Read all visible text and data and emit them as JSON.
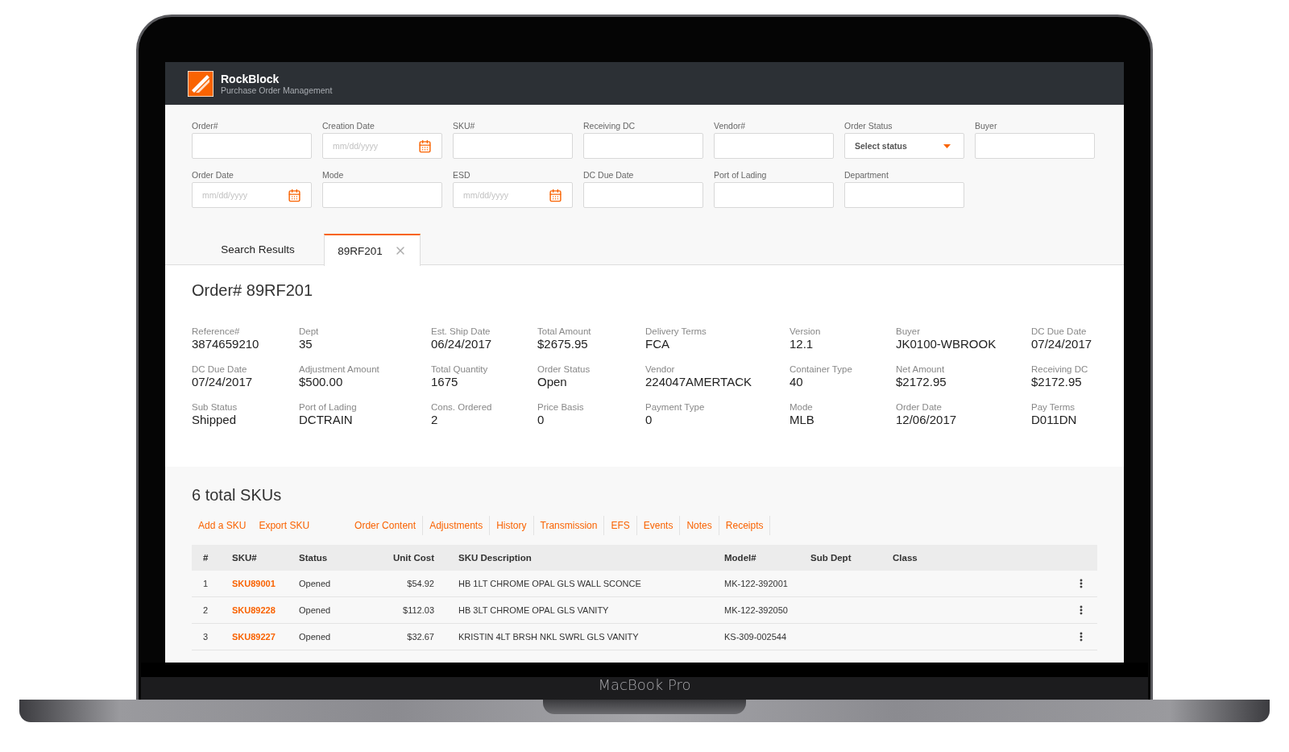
{
  "app": {
    "title": "RockBlock",
    "subtitle": "Purchase Order Management"
  },
  "filters": [
    {
      "label": "Order#",
      "kind": "text"
    },
    {
      "label": "Creation Date",
      "kind": "date",
      "placeholder": "mm/dd/yyyy"
    },
    {
      "label": "SKU#",
      "kind": "text"
    },
    {
      "label": "Receiving DC",
      "kind": "text"
    },
    {
      "label": "Vendor#",
      "kind": "text"
    },
    {
      "label": "Order Status",
      "kind": "select",
      "value": "Select status"
    },
    {
      "label": "Buyer",
      "kind": "text"
    },
    {
      "label": "Order Date",
      "kind": "date",
      "placeholder": "mm/dd/yyyy"
    },
    {
      "label": "Mode",
      "kind": "text"
    },
    {
      "label": "ESD",
      "kind": "date",
      "placeholder": "mm/dd/yyyy"
    },
    {
      "label": "DC Due Date",
      "kind": "text"
    },
    {
      "label": "Port of Lading",
      "kind": "text"
    },
    {
      "label": "Department",
      "kind": "text"
    }
  ],
  "tabs": [
    {
      "label": "Search Results",
      "selected": false,
      "closable": false
    },
    {
      "label": "89RF201",
      "selected": true,
      "closable": true
    }
  ],
  "order": {
    "title": "Order# 89RF201",
    "fields": [
      {
        "label": "Reference#",
        "value": "3874659210"
      },
      {
        "label": "Dept",
        "value": "35"
      },
      {
        "label": "Est. Ship Date",
        "value": "06/24/2017"
      },
      {
        "label": "Total Amount",
        "value": "$2675.95"
      },
      {
        "label": "Delivery Terms",
        "value": "FCA"
      },
      {
        "label": "Version",
        "value": "12.1"
      },
      {
        "label": "Buyer",
        "value": "JK0100-WBROOK"
      },
      {
        "label": "DC Due Date",
        "value": "07/24/2017"
      },
      {
        "label": "DC Due Date",
        "value": "07/24/2017"
      },
      {
        "label": "Adjustment Amount",
        "value": "$500.00"
      },
      {
        "label": "Total Quantity",
        "value": "1675"
      },
      {
        "label": "Order Status",
        "value": "Open"
      },
      {
        "label": "Vendor",
        "value": "224047AMERTACK"
      },
      {
        "label": "Container Type",
        "value": "40"
      },
      {
        "label": "Net Amount",
        "value": "$2172.95"
      },
      {
        "label": "Receiving DC",
        "value": "$2172.95"
      },
      {
        "label": "Sub Status",
        "value": "Shipped"
      },
      {
        "label": "Port of Lading",
        "value": "DCTRAIN"
      },
      {
        "label": "Cons. Ordered",
        "value": "2"
      },
      {
        "label": "Price Basis",
        "value": "0"
      },
      {
        "label": "Payment Type",
        "value": "0"
      },
      {
        "label": "Mode",
        "value": "MLB"
      },
      {
        "label": "Order Date",
        "value": "12/06/2017"
      },
      {
        "label": "Pay Terms",
        "value": "D011DN"
      }
    ]
  },
  "skus": {
    "title": "6 total SKUs",
    "actions": [
      {
        "label": "Add a SKU",
        "kind": "action"
      },
      {
        "label": "Export SKU",
        "kind": "action"
      },
      {
        "label": "Order Content",
        "kind": "tab"
      },
      {
        "label": "Adjustments",
        "kind": "tab"
      },
      {
        "label": "History",
        "kind": "tab"
      },
      {
        "label": "Transmission",
        "kind": "tab"
      },
      {
        "label": "EFS",
        "kind": "tab"
      },
      {
        "label": "Events",
        "kind": "tab"
      },
      {
        "label": "Notes",
        "kind": "tab"
      },
      {
        "label": "Receipts",
        "kind": "tab"
      }
    ],
    "table": {
      "columns": [
        "#",
        "SKU#",
        "Status",
        "Unit Cost",
        "SKU Description",
        "Model#",
        "Sub Dept",
        "Class"
      ],
      "rows": [
        [
          "1",
          "SKU89001",
          "Opened",
          "$54.92",
          "HB 1LT CHROME OPAL GLS WALL SCONCE",
          "MK-122-392001"
        ],
        [
          "2",
          "SKU89228",
          "Opened",
          "$112.03",
          "HB 3LT CHROME OPAL GLS VANITY",
          "MK-122-392050"
        ],
        [
          "3",
          "SKU89227",
          "Opened",
          "$32.67",
          "KRISTIN 4LT BRSH NKL SWRL GLS VANITY",
          "KS-309-002544"
        ]
      ]
    }
  },
  "device": {
    "label": "MacBook Pro"
  }
}
